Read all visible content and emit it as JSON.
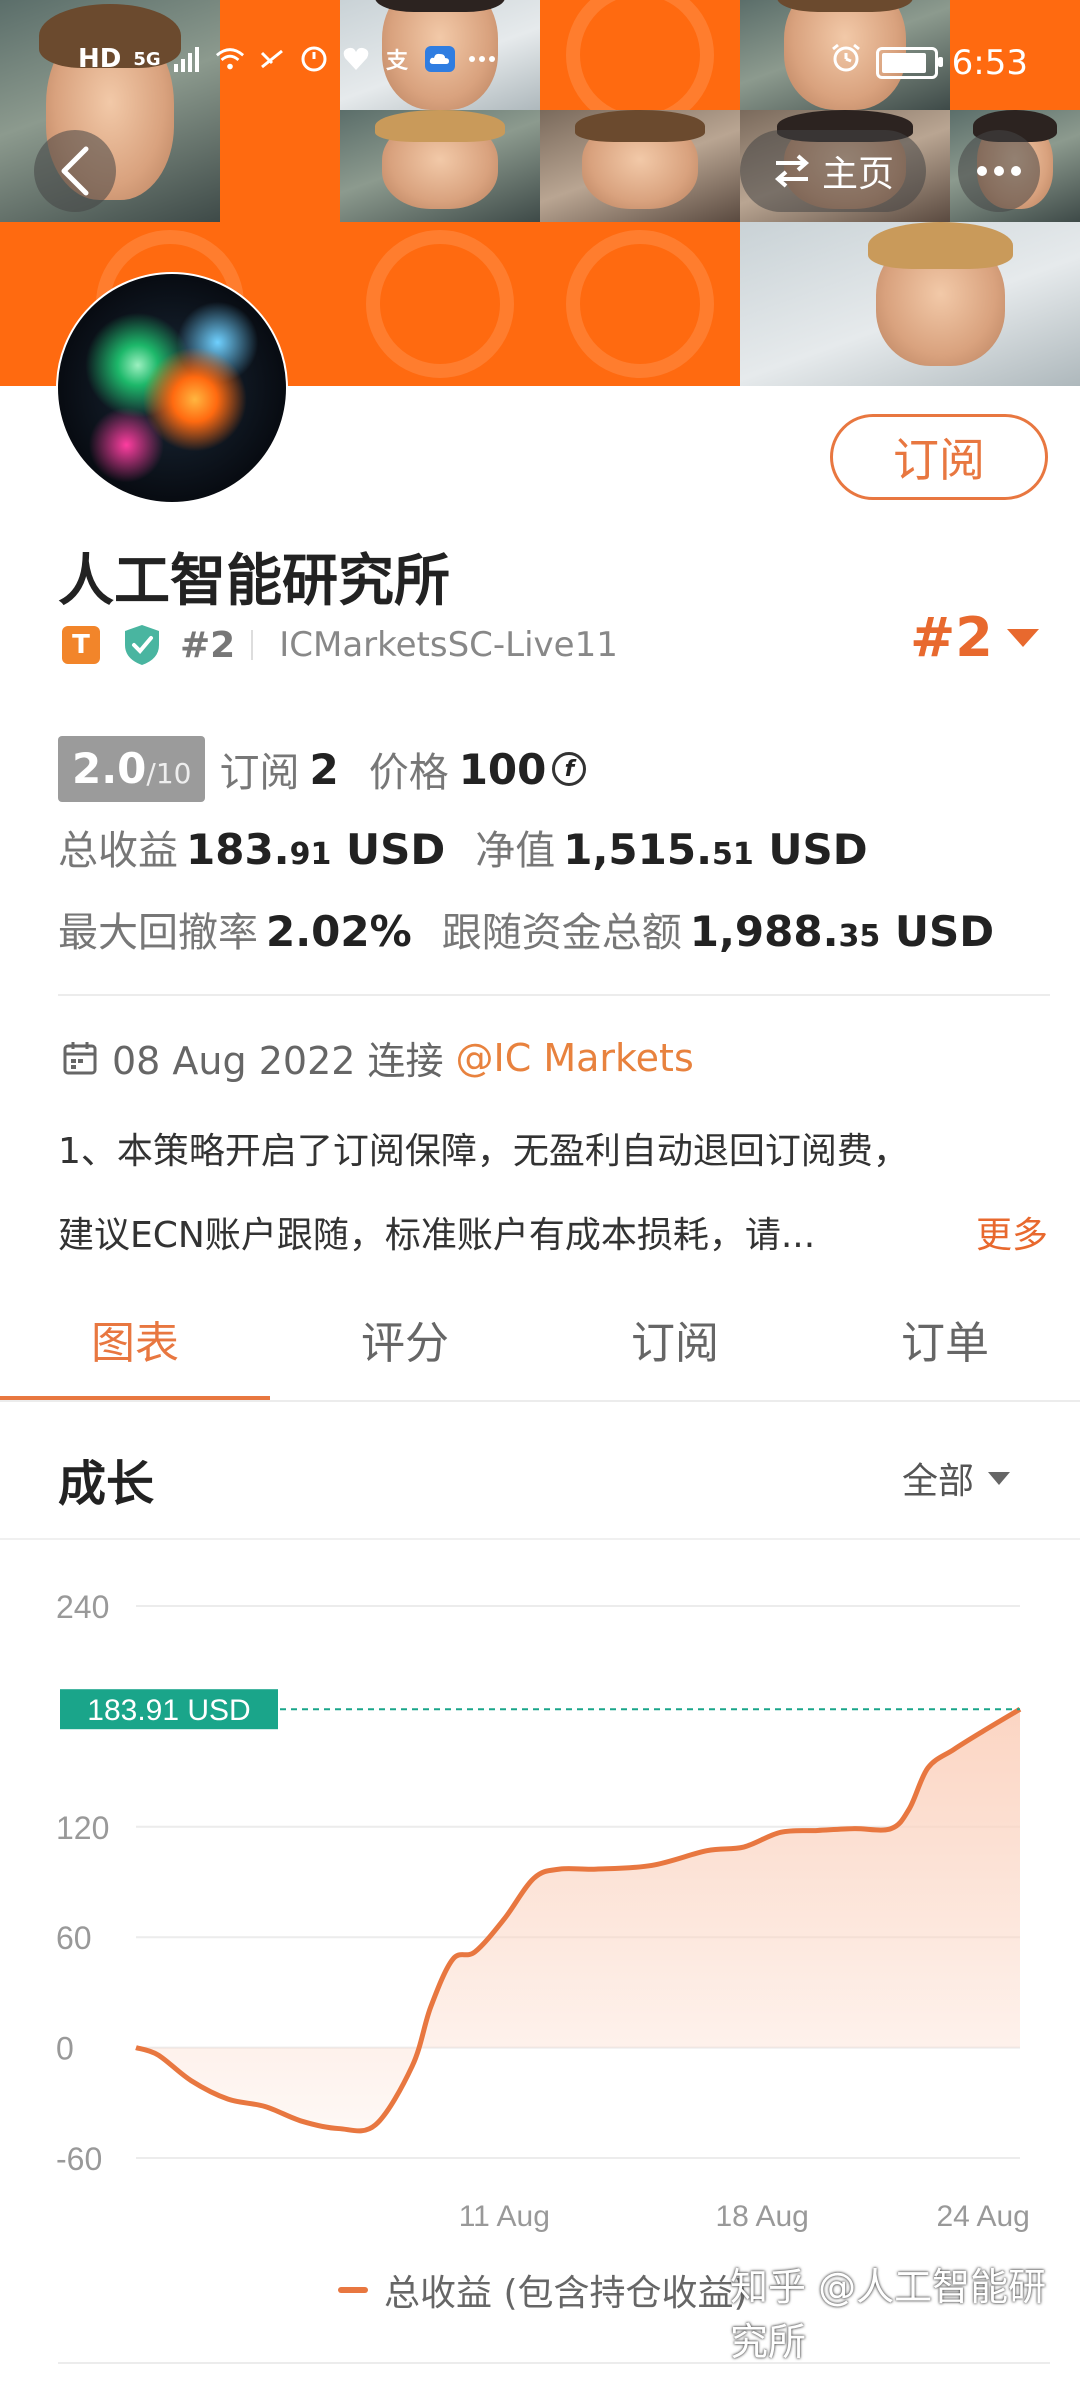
{
  "status_bar": {
    "left_icons": [
      "HD",
      "5G"
    ],
    "time": "6:53"
  },
  "header": {
    "home_label": "主页"
  },
  "profile": {
    "subscribe_label": "订阅",
    "name": "人工智能研究所",
    "tag_t": "T",
    "rank_small": "#2",
    "account": "ICMarketsSC-Live11",
    "rank_big": "#2"
  },
  "stats": {
    "score_value": "2.0",
    "score_max": "/10",
    "subscribe_label": "订阅",
    "subscribe_count": "2",
    "price_label": "价格",
    "price_value": "100",
    "coin_symbol": "f",
    "total_profit_label": "总收益",
    "total_profit_int": "183.",
    "total_profit_dec": "91",
    "total_profit_unit": " USD",
    "equity_label": "净值",
    "equity_int": "1,515.",
    "equity_dec": "51",
    "equity_unit": " USD",
    "max_drawdown_label": "最大回撤率",
    "max_drawdown_value": "2.02%",
    "follow_funds_label": "跟随资金总额",
    "follow_funds_int": "1,988.",
    "follow_funds_dec": "35",
    "follow_funds_unit": " USD"
  },
  "connection": {
    "date": "08 Aug 2022 连接",
    "broker": "@IC Markets"
  },
  "description": {
    "line1": "1、本策略开启了订阅保障，无盈利自动退回订阅费，",
    "line2": "建议ECN账户跟随，标准账户有成本损耗，请...",
    "more_label": "更多"
  },
  "tabs": [
    {
      "label": "图表",
      "active": true
    },
    {
      "label": "评分",
      "active": false
    },
    {
      "label": "订阅",
      "active": false
    },
    {
      "label": "订单",
      "active": false
    }
  ],
  "growth": {
    "title": "成长",
    "range_label": "全部"
  },
  "chart_data": {
    "type": "area",
    "y_ticks": [
      "240",
      "120",
      "60",
      "0",
      "-60"
    ],
    "ylim": [
      -60,
      240
    ],
    "x_ticks": [
      {
        "label": "11 Aug",
        "x": 11
      },
      {
        "label": "18 Aug",
        "x": 18
      },
      {
        "label": "24 Aug",
        "x": 24
      }
    ],
    "xlim": [
      1,
      25
    ],
    "current_label": "183.91 USD",
    "current_value": 183.91,
    "series": [
      {
        "name": "总收益 (包含持仓收益)",
        "x": [
          1,
          1.6,
          2.5,
          3.5,
          4.5,
          5.5,
          6.5,
          7.5,
          8.5,
          9,
          9.6,
          10.2,
          11,
          11.8,
          12.5,
          13.5,
          15,
          16.5,
          17.5,
          18.5,
          19.5,
          20.5,
          21.5,
          22,
          22.5,
          23.2,
          24,
          25
        ],
        "y": [
          0,
          -4,
          -18,
          -28,
          -32,
          -40,
          -44,
          -42,
          -10,
          22,
          48,
          52,
          70,
          92,
          97,
          97,
          99,
          107,
          109,
          117,
          118,
          119,
          119,
          130,
          152,
          162,
          172,
          183.91
        ]
      }
    ],
    "legend_position": "bottom-center",
    "colors": {
      "line": "#e87740",
      "fill": "#fbd3c0",
      "label_bg": "#1aa58a"
    }
  },
  "legend": {
    "label": "总收益 (包含持仓收益)"
  },
  "watermark": "知乎 @人工智能研究所"
}
